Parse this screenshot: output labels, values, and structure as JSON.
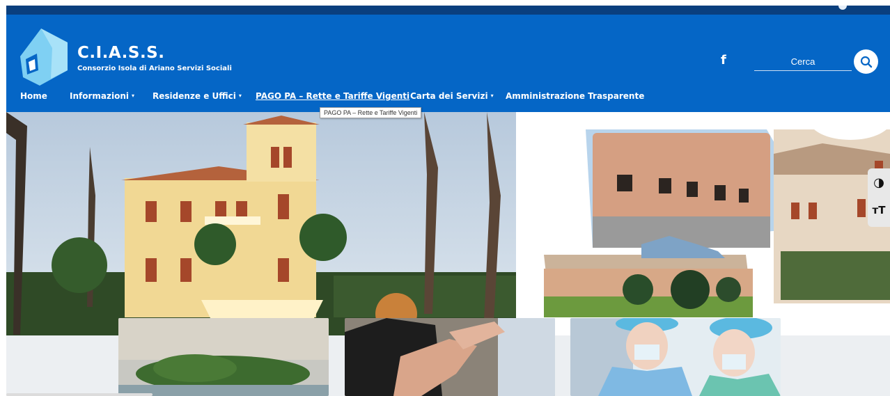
{
  "brand": {
    "title": "C.I.A.S.S.",
    "subtitle": "Consorzio Isola di Ariano Servizi Sociali",
    "logo_icon": "house-logo-icon"
  },
  "colors": {
    "header_blue": "#0566c6",
    "topbar_navy": "#0a3f7e",
    "page_bg": "#eceff2"
  },
  "social": {
    "facebook_label": "f"
  },
  "search": {
    "placeholder": "Cerca",
    "icon": "search-icon"
  },
  "nav": {
    "items": [
      {
        "label": "Home",
        "dropdown": false
      },
      {
        "label": "Informazioni",
        "dropdown": true
      },
      {
        "label": "Residenze e Uffici",
        "dropdown": true
      },
      {
        "label": "PAGO PA – Rette e Tariffe Vigenti",
        "dropdown": false,
        "hovered": true
      },
      {
        "label": "Carta dei Servizi",
        "dropdown": true
      },
      {
        "label": "Amministrazione Trasparente",
        "dropdown": false
      }
    ],
    "caret": "▾"
  },
  "tooltip": {
    "text": "PAGO PA – Rette e Tariffe Vigenti"
  },
  "accessibility": {
    "contrast_icon": "contrast-icon",
    "contrast_glyph": "◑",
    "text_size_icon": "text-size-icon",
    "text_size_glyph": "ᴛT"
  }
}
